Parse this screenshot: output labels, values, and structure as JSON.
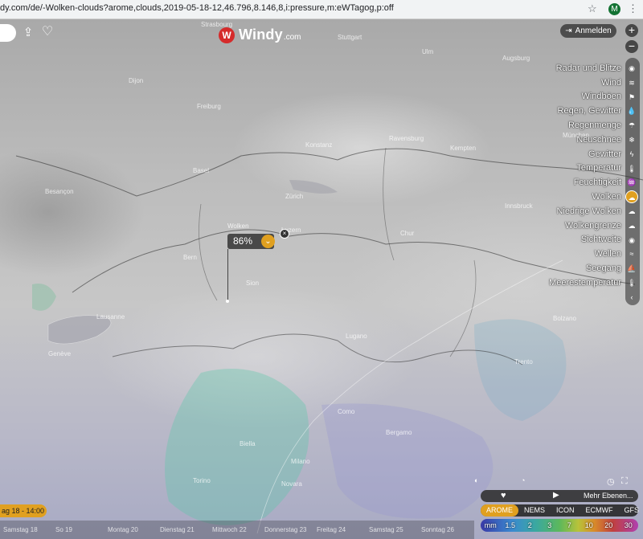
{
  "browser": {
    "url": "dy.com/de/-Wolken-clouds?arome,clouds,2019-05-18-12,46.796,8.146,8,i:pressure,m:eWTagog,p:off",
    "profile_initial": "M"
  },
  "logo": {
    "brand": "Windy",
    "tld": ".com"
  },
  "login": {
    "label": "Anmelden"
  },
  "zoom": {
    "in": "+",
    "out": "−"
  },
  "layers": [
    {
      "label": "Radar und Blitze",
      "icon": "radar-icon",
      "glyph": "◉"
    },
    {
      "label": "Wind",
      "icon": "wind-icon",
      "glyph": "≋"
    },
    {
      "label": "Windböen",
      "icon": "flag-icon",
      "glyph": "⚑"
    },
    {
      "label": "Regen, Gewitter",
      "icon": "drop-icon",
      "glyph": "💧"
    },
    {
      "label": "Regenmenge",
      "icon": "cloud-rain-icon",
      "glyph": "☂"
    },
    {
      "label": "Neuschnee",
      "icon": "snowflake-icon",
      "glyph": "❄"
    },
    {
      "label": "Gewitter",
      "icon": "lightning-icon",
      "glyph": "ϟ"
    },
    {
      "label": "Temperatur",
      "icon": "thermometer-icon",
      "glyph": "🌡"
    },
    {
      "label": "Feuchtigkeit",
      "icon": "humidity-icon",
      "glyph": "♒"
    },
    {
      "label": "Wolken",
      "icon": "clouds-icon",
      "glyph": "☁",
      "active": true
    },
    {
      "label": "Niedrige Wolken",
      "icon": "low-clouds-icon",
      "glyph": "☁"
    },
    {
      "label": "Wolkengrenze",
      "icon": "cloud-base-icon",
      "glyph": "☁"
    },
    {
      "label": "Sichtweite",
      "icon": "eye-icon",
      "glyph": "◉"
    },
    {
      "label": "Wellen",
      "icon": "waves-icon",
      "glyph": "≈"
    },
    {
      "label": "Seegang",
      "icon": "swell-icon",
      "glyph": "⛵"
    },
    {
      "label": "Meerestemperatur",
      "icon": "sea-temp-icon",
      "glyph": "🌡"
    },
    {
      "label": "Mehr Ebenen...",
      "icon": "collapse-icon",
      "glyph": "‹"
    }
  ],
  "popup": {
    "layer": "Wolken",
    "value": "86%"
  },
  "timeline": {
    "current": "ag 18 - 14:00",
    "days": [
      "Samstag 18",
      "So 19",
      "Montag 20",
      "Dienstag 21",
      "Mittwoch 22",
      "Donnerstag 23",
      "Freitag 24",
      "Samstag 25",
      "Sonntag 26"
    ]
  },
  "bottom_toggles": {
    "left": "particle animation",
    "right": "clock"
  },
  "panel": {
    "more_layers": "Mehr Ebenen...",
    "models": [
      "AROME",
      "NEMS",
      "ICON",
      "ECMWF",
      "GFS"
    ],
    "active_model": "AROME",
    "legend_unit": "mm",
    "legend_values": [
      "1.5",
      "2",
      "3",
      "7",
      "10",
      "20",
      "30"
    ]
  },
  "map_labels": [
    "Strasbourg",
    "Stuttgart",
    "Ulm",
    "Augsburg",
    "München",
    "Freiburg",
    "Basel",
    "Zürich",
    "Konstanz",
    "Ravensburg",
    "Kempten",
    "Bern",
    "Luzern",
    "Lausanne",
    "Genève",
    "Sion",
    "Bolzano",
    "Trento",
    "Como",
    "Bergamo",
    "Milano",
    "Torino",
    "Biella",
    "Novara",
    "Chur",
    "Lugano",
    "Innsbruck",
    "Besançon",
    "Dijon"
  ],
  "colors": {
    "accent": "#e0a020",
    "brand": "#d52b2b",
    "dark_panel": "#3c3c3c"
  }
}
